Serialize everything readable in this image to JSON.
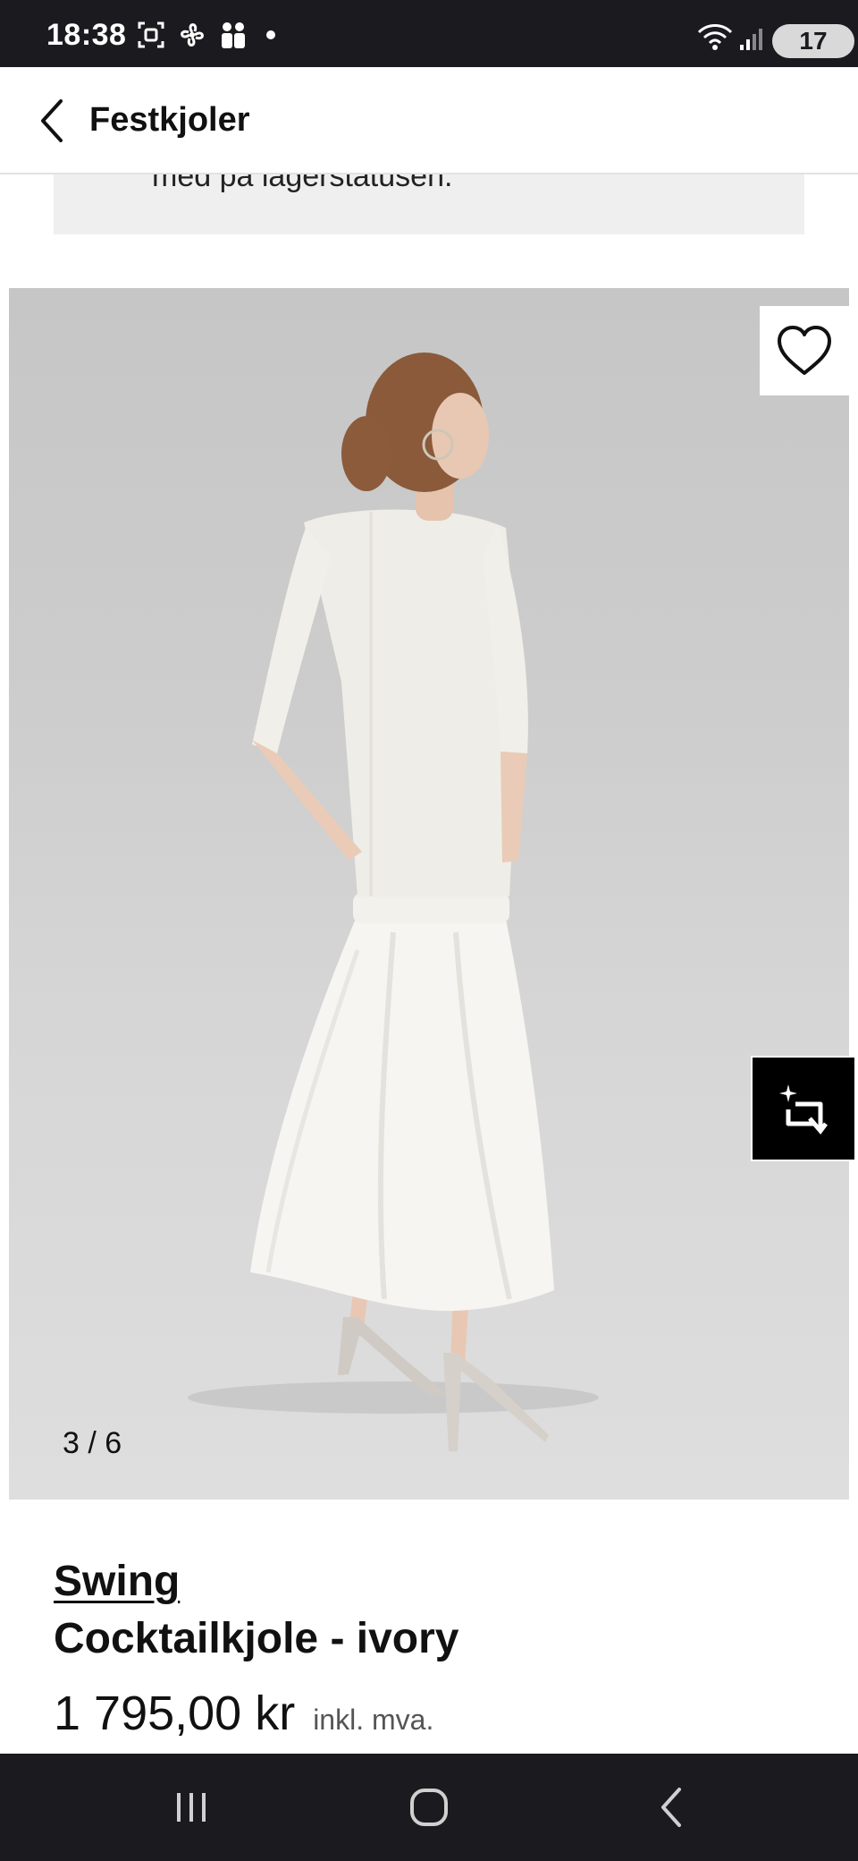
{
  "status_bar": {
    "time": "18:38",
    "battery": "17"
  },
  "header": {
    "title": "Festkjoler"
  },
  "stock_notice": {
    "text": "med på lagerstatusen."
  },
  "gallery": {
    "counter": "3 / 6"
  },
  "product": {
    "brand": "Swing",
    "name": "Cocktailkjole - ivory",
    "price": "1 795,00 kr",
    "vat_label": "inkl. mva."
  },
  "colors": {
    "status_bar_bg": "#1b1b1f",
    "notice_bg": "#efefef",
    "image_bg": "#cdcdcd",
    "accent": "#000000"
  },
  "icons": {
    "back": "chevron-left-icon",
    "wishlist": "heart-outline-icon",
    "ai_assistant": "sparkle-crop-icon",
    "nav_recents": "recents-icon",
    "nav_home": "home-icon",
    "nav_back": "back-icon"
  }
}
